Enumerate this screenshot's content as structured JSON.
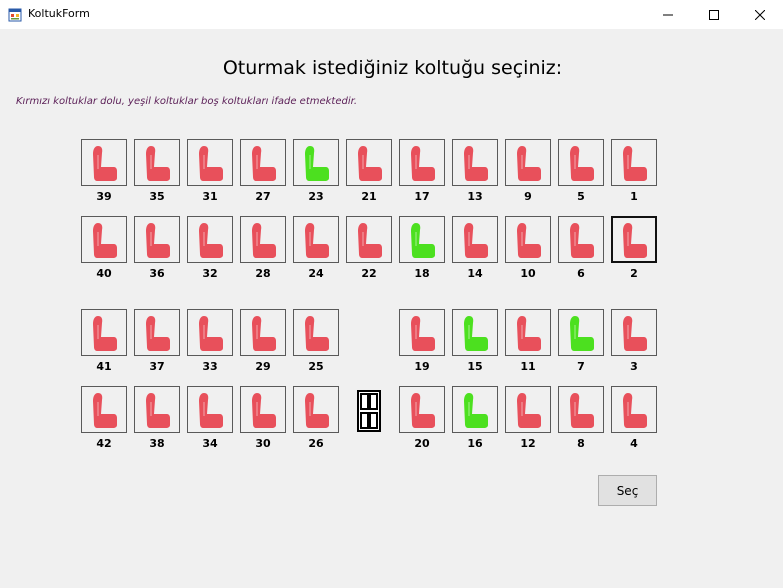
{
  "window": {
    "title": "KoltukForm",
    "minimize_icon": "minimize-icon",
    "maximize_icon": "maximize-icon",
    "close_icon": "close-icon"
  },
  "heading": "Oturmak istediğiniz koltuğu seçiniz:",
  "legend": "Kırmızı koltuklar dolu, yeşil koltuklar boş koltukları ifade etmektedir.",
  "colors": {
    "occupied": "#e8505b",
    "empty": "#4ce01f"
  },
  "seat_rows": [
    [
      "39",
      "35",
      "31",
      "27",
      "23",
      "21",
      "17",
      "13",
      "9",
      "5",
      "1"
    ],
    [
      "40",
      "36",
      "32",
      "28",
      "24",
      "22",
      "18",
      "14",
      "10",
      "6",
      "2"
    ],
    [
      "41",
      "37",
      "33",
      "29",
      "25",
      "19",
      "15",
      "11",
      "7",
      "3"
    ],
    [
      "42",
      "38",
      "34",
      "30",
      "26",
      "20",
      "16",
      "12",
      "8",
      "4"
    ]
  ],
  "empty_seats": [
    "23",
    "18",
    "15",
    "7",
    "16"
  ],
  "selected_seat": "2",
  "door_icon": "door-icon",
  "seat_icon": "seat-icon",
  "select_button": "Seç"
}
